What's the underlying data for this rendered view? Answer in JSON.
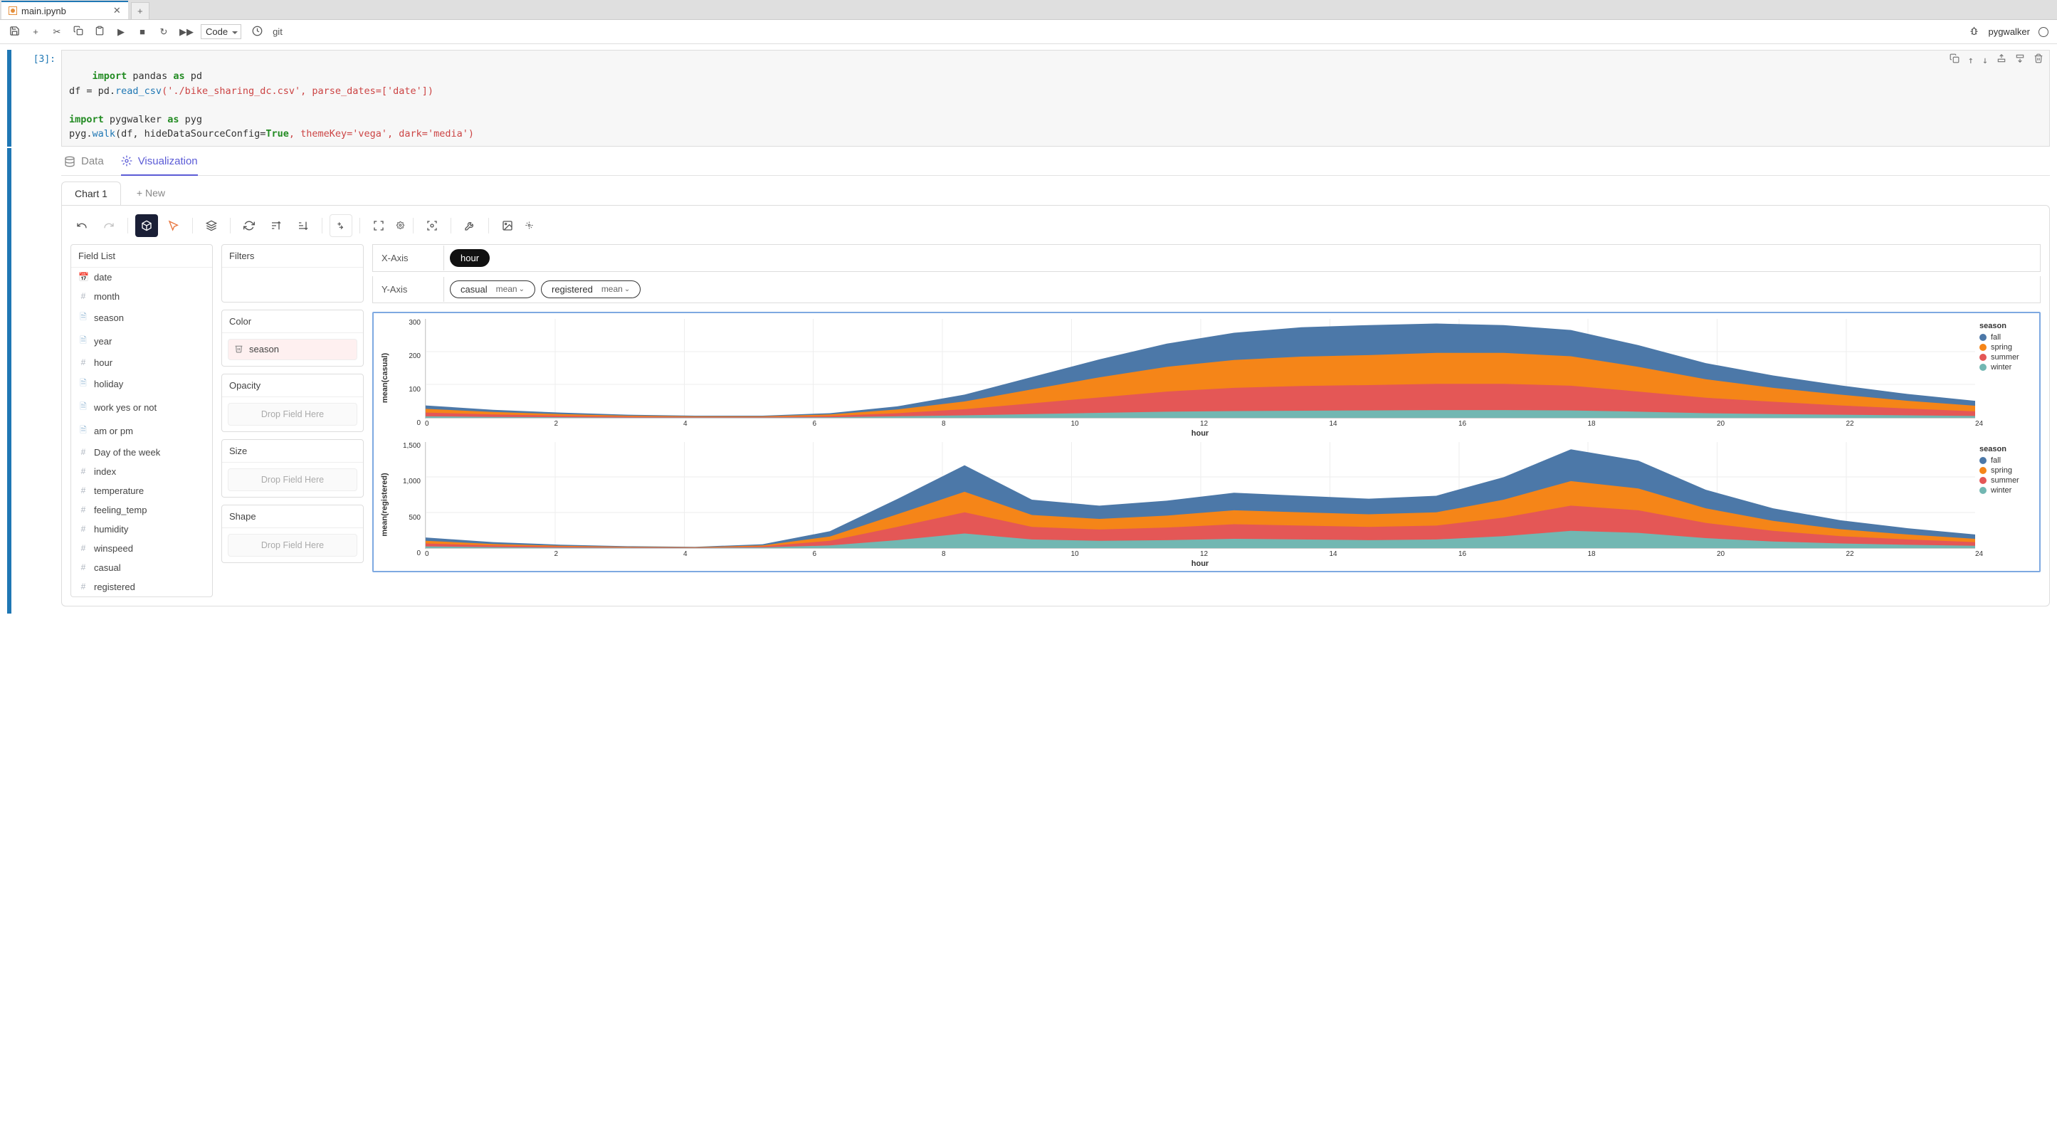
{
  "tabs": {
    "file_name": "main.ipynb"
  },
  "toolbar": {
    "cell_type": "Code",
    "git_label": "git",
    "kernel_name": "pygwalker"
  },
  "cell": {
    "prompt": "[3]:",
    "code_lines": [
      {
        "kw": "import",
        "mid": " pandas ",
        "as": "as",
        "alias": " pd"
      },
      {
        "raw": "df = pd.",
        "fn": "read_csv",
        "args": "('./bike_sharing_dc.csv', parse_dates=['date'])"
      },
      {
        "blank": true
      },
      {
        "kw": "import",
        "mid": " pygwalker ",
        "as": "as",
        "alias": " pyg"
      },
      {
        "raw": "pyg.",
        "fn": "walk",
        "args": "(df, hideDataSourceConfig=",
        "bool": "True",
        "args2": ", themeKey='vega', dark='media')"
      }
    ]
  },
  "pyg": {
    "top_tabs": {
      "data": "Data",
      "viz": "Visualization"
    },
    "chart_tabs": {
      "active": "Chart 1",
      "new": "+ New"
    },
    "field_list_label": "Field List",
    "fields": [
      {
        "icon": "date",
        "label": "date"
      },
      {
        "icon": "hash",
        "label": "month"
      },
      {
        "icon": "doc",
        "label": "season"
      },
      {
        "icon": "doc",
        "label": "year"
      },
      {
        "icon": "hash",
        "label": "hour"
      },
      {
        "icon": "doc",
        "label": "holiday"
      },
      {
        "icon": "doc",
        "label": "work yes or not"
      },
      {
        "icon": "doc",
        "label": "am or pm"
      },
      {
        "icon": "hash",
        "label": "Day of the week"
      },
      {
        "icon": "hash",
        "label": "index"
      },
      {
        "icon": "hash",
        "label": "temperature"
      },
      {
        "icon": "hash",
        "label": "feeling_temp"
      },
      {
        "icon": "hash",
        "label": "humidity"
      },
      {
        "icon": "hash",
        "label": "winspeed"
      },
      {
        "icon": "hash",
        "label": "casual"
      },
      {
        "icon": "hash",
        "label": "registered"
      }
    ],
    "shelves": {
      "filters": "Filters",
      "color": "Color",
      "color_field": "season",
      "opacity": "Opacity",
      "size": "Size",
      "shape": "Shape",
      "drop_text": "Drop Field Here"
    },
    "axes": {
      "x_label": "X-Axis",
      "y_label": "Y-Axis",
      "x_pill": "hour",
      "y_pill1": "casual",
      "y_pill1_agg": "mean",
      "y_pill2": "registered",
      "y_pill2_agg": "mean"
    },
    "legend": {
      "title": "season",
      "items": [
        {
          "label": "fall",
          "color": "#4c78a8"
        },
        {
          "label": "spring",
          "color": "#f58518"
        },
        {
          "label": "summer",
          "color": "#e45756"
        },
        {
          "label": "winter",
          "color": "#72b7b2"
        }
      ]
    },
    "chart1": {
      "ylabel": "mean(casual)",
      "xlabel": "hour",
      "yticks": [
        "300",
        "200",
        "100",
        "0"
      ],
      "xticks": [
        "0",
        "2",
        "4",
        "6",
        "8",
        "10",
        "12",
        "14",
        "16",
        "18",
        "20",
        "22",
        "24"
      ]
    },
    "chart2": {
      "ylabel": "mean(registered)",
      "xlabel": "hour",
      "yticks": [
        "1,500",
        "1,000",
        "500",
        "0"
      ],
      "xticks": [
        "0",
        "2",
        "4",
        "6",
        "8",
        "10",
        "12",
        "14",
        "16",
        "18",
        "20",
        "22",
        "24"
      ]
    }
  },
  "chart_data": [
    {
      "type": "area",
      "title": "mean(casual) by hour, stacked by season",
      "xlabel": "hour",
      "ylabel": "mean(casual)",
      "x": [
        0,
        1,
        2,
        3,
        4,
        5,
        6,
        7,
        8,
        9,
        10,
        11,
        12,
        13,
        14,
        15,
        16,
        17,
        18,
        19,
        20,
        21,
        22,
        23
      ],
      "ylim": [
        0,
        320
      ],
      "series": [
        {
          "name": "winter",
          "color": "#72b7b2",
          "values": [
            5,
            3,
            2,
            1,
            1,
            1,
            2,
            5,
            8,
            12,
            16,
            20,
            22,
            23,
            24,
            25,
            25,
            24,
            20,
            15,
            12,
            10,
            8,
            6
          ]
        },
        {
          "name": "summer",
          "color": "#e45756",
          "values": [
            12,
            8,
            5,
            3,
            2,
            2,
            4,
            10,
            20,
            35,
            50,
            65,
            75,
            80,
            82,
            85,
            85,
            80,
            65,
            50,
            40,
            30,
            22,
            15
          ]
        },
        {
          "name": "spring",
          "color": "#f58518",
          "values": [
            12,
            8,
            5,
            3,
            2,
            2,
            5,
            12,
            25,
            45,
            65,
            80,
            90,
            95,
            97,
            100,
            100,
            95,
            80,
            60,
            45,
            35,
            25,
            18
          ]
        },
        {
          "name": "fall",
          "color": "#4c78a8",
          "values": [
            11,
            7,
            5,
            3,
            2,
            2,
            4,
            10,
            22,
            40,
            58,
            75,
            88,
            95,
            97,
            95,
            90,
            85,
            70,
            52,
            40,
            30,
            22,
            16
          ]
        }
      ]
    },
    {
      "type": "area",
      "title": "mean(registered) by hour, stacked by season",
      "xlabel": "hour",
      "ylabel": "mean(registered)",
      "x": [
        0,
        1,
        2,
        3,
        4,
        5,
        6,
        7,
        8,
        9,
        10,
        11,
        12,
        13,
        14,
        15,
        16,
        17,
        18,
        19,
        20,
        21,
        22,
        23
      ],
      "ylim": [
        0,
        1600
      ],
      "series": [
        {
          "name": "winter",
          "color": "#72b7b2",
          "values": [
            25,
            15,
            8,
            5,
            3,
            10,
            40,
            120,
            220,
            130,
            110,
            120,
            140,
            130,
            120,
            130,
            180,
            260,
            230,
            150,
            100,
            70,
            50,
            35
          ]
        },
        {
          "name": "summer",
          "color": "#e45756",
          "values": [
            45,
            25,
            15,
            8,
            5,
            15,
            70,
            200,
            320,
            190,
            170,
            190,
            220,
            210,
            200,
            210,
            280,
            380,
            340,
            230,
            160,
            110,
            80,
            55
          ]
        },
        {
          "name": "spring",
          "color": "#f58518",
          "values": [
            40,
            22,
            12,
            7,
            5,
            15,
            65,
            190,
            310,
            180,
            160,
            180,
            210,
            200,
            190,
            200,
            270,
            370,
            330,
            220,
            150,
            105,
            75,
            50
          ]
        },
        {
          "name": "fall",
          "color": "#4c78a8",
          "values": [
            50,
            28,
            16,
            9,
            6,
            18,
            80,
            230,
            400,
            230,
            200,
            225,
            265,
            250,
            235,
            250,
            340,
            480,
            420,
            280,
            190,
            135,
            95,
            65
          ]
        }
      ]
    }
  ]
}
